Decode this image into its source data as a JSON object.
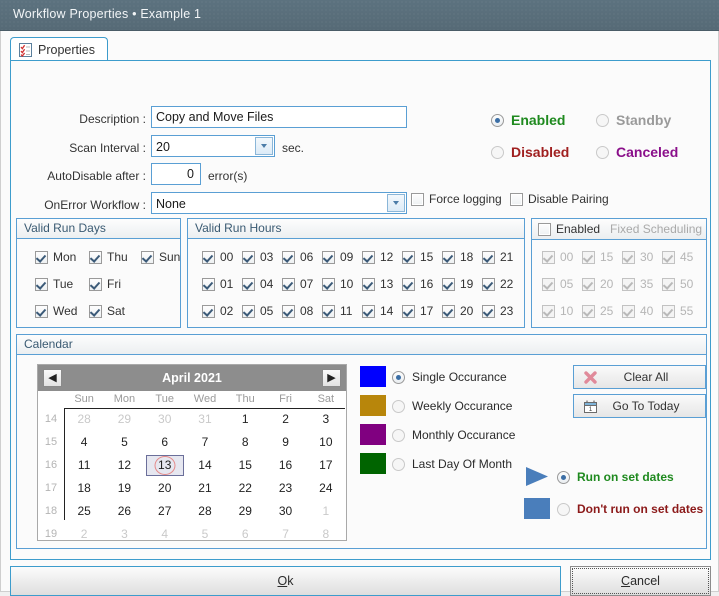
{
  "window": {
    "title": "Workflow Properties • Example 1"
  },
  "tab": {
    "label": "Properties",
    "icon": "checklist-icon"
  },
  "form": {
    "description_label": "Description :",
    "description_value": "Copy and Move Files",
    "scan_interval_label": "Scan Interval :",
    "scan_interval_value": "20",
    "scan_interval_unit": "sec.",
    "autodisable_label": "AutoDisable after :",
    "autodisable_value": "0",
    "autodisable_unit": "error(s)",
    "onerror_label": "OnError Workflow :",
    "onerror_value": "None",
    "force_logging_label": "Force logging",
    "force_logging_checked": false,
    "disable_pairing_label": "Disable Pairing",
    "disable_pairing_checked": false
  },
  "status": {
    "selected": "Enabled",
    "options": [
      {
        "label": "Enabled",
        "color": "#1f8a1f",
        "selected": true
      },
      {
        "label": "Standby",
        "color": "#9a9a9a",
        "selected": false
      },
      {
        "label": "Disabled",
        "color": "#a02020",
        "selected": false
      },
      {
        "label": "Canceled",
        "color": "#8a0f8a",
        "selected": false
      }
    ]
  },
  "valid_run_days": {
    "title": "Valid Run Days",
    "items": [
      {
        "label": "Mon",
        "checked": true
      },
      {
        "label": "Thu",
        "checked": true
      },
      {
        "label": "Sun",
        "checked": true
      },
      {
        "label": "Tue",
        "checked": true
      },
      {
        "label": "Fri",
        "checked": true
      },
      {
        "label": "Wed",
        "checked": true
      },
      {
        "label": "Sat",
        "checked": true
      }
    ]
  },
  "valid_run_hours": {
    "title": "Valid Run Hours",
    "rows": [
      [
        "00",
        "03",
        "06",
        "09",
        "12",
        "15",
        "18",
        "21"
      ],
      [
        "01",
        "04",
        "07",
        "10",
        "13",
        "16",
        "19",
        "22"
      ],
      [
        "02",
        "05",
        "08",
        "11",
        "14",
        "17",
        "20",
        "23"
      ]
    ],
    "all_checked": true
  },
  "fixed_scheduling": {
    "enabled_label": "Enabled",
    "enabled_checked": false,
    "title": "Fixed Scheduling",
    "disabled": true,
    "rows": [
      [
        "00",
        "15",
        "30",
        "45"
      ],
      [
        "05",
        "20",
        "35",
        "50"
      ],
      [
        "10",
        "25",
        "40",
        "55"
      ]
    ],
    "all_checked": true
  },
  "calendar": {
    "title": "Calendar",
    "month_label": "April 2021",
    "prev_icon": "chevron-left-icon",
    "next_icon": "chevron-right-icon",
    "dow": [
      "Sun",
      "Mon",
      "Tue",
      "Wed",
      "Thu",
      "Fri",
      "Sat"
    ],
    "week_numbers": [
      "14",
      "15",
      "16",
      "17",
      "18",
      "19"
    ],
    "weeks": [
      [
        {
          "d": "28",
          "out": true
        },
        {
          "d": "29",
          "out": true
        },
        {
          "d": "30",
          "out": true
        },
        {
          "d": "31",
          "out": true
        },
        {
          "d": "1"
        },
        {
          "d": "2"
        },
        {
          "d": "3"
        }
      ],
      [
        {
          "d": "4"
        },
        {
          "d": "5"
        },
        {
          "d": "6"
        },
        {
          "d": "7"
        },
        {
          "d": "8"
        },
        {
          "d": "9"
        },
        {
          "d": "10"
        }
      ],
      [
        {
          "d": "11"
        },
        {
          "d": "12"
        },
        {
          "d": "13",
          "selected": true,
          "today": true
        },
        {
          "d": "14"
        },
        {
          "d": "15"
        },
        {
          "d": "16"
        },
        {
          "d": "17"
        }
      ],
      [
        {
          "d": "18"
        },
        {
          "d": "19"
        },
        {
          "d": "20"
        },
        {
          "d": "21"
        },
        {
          "d": "22"
        },
        {
          "d": "23"
        },
        {
          "d": "24"
        }
      ],
      [
        {
          "d": "25"
        },
        {
          "d": "26"
        },
        {
          "d": "27"
        },
        {
          "d": "28"
        },
        {
          "d": "29"
        },
        {
          "d": "30"
        },
        {
          "d": "1",
          "out": true
        }
      ],
      [
        {
          "d": "2",
          "out": true
        },
        {
          "d": "3",
          "out": true
        },
        {
          "d": "4",
          "out": true
        },
        {
          "d": "5",
          "out": true
        },
        {
          "d": "6",
          "out": true
        },
        {
          "d": "7",
          "out": true
        },
        {
          "d": "8",
          "out": true
        }
      ]
    ]
  },
  "occurrence": {
    "items": [
      {
        "label": "Single Occurance",
        "color": "#0000ff",
        "selected": true
      },
      {
        "label": "Weekly Occurance",
        "color": "#b8860b",
        "selected": false
      },
      {
        "label": "Monthly Occurance",
        "color": "#800080",
        "selected": false
      },
      {
        "label": "Last Day Of Month",
        "color": "#006400",
        "selected": false
      }
    ]
  },
  "run_mode": {
    "items": [
      {
        "label": "Run on set dates",
        "color": "#1f8a1f",
        "swatch": "#4a7ebb",
        "shape": "triangle",
        "selected": true
      },
      {
        "label": "Don't run on set dates",
        "color": "#8c1a1a",
        "swatch": "#4a7ebb",
        "shape": "square",
        "selected": false
      }
    ]
  },
  "calendar_buttons": {
    "clear_all": {
      "label": "Clear All",
      "icon": "x-mark-icon"
    },
    "go_today": {
      "label": "Go To Today",
      "icon": "calendar-icon"
    }
  },
  "footer": {
    "ok_label": "Ok",
    "ok_accel": "O",
    "cancel_label": "Cancel",
    "cancel_accel": "C"
  }
}
